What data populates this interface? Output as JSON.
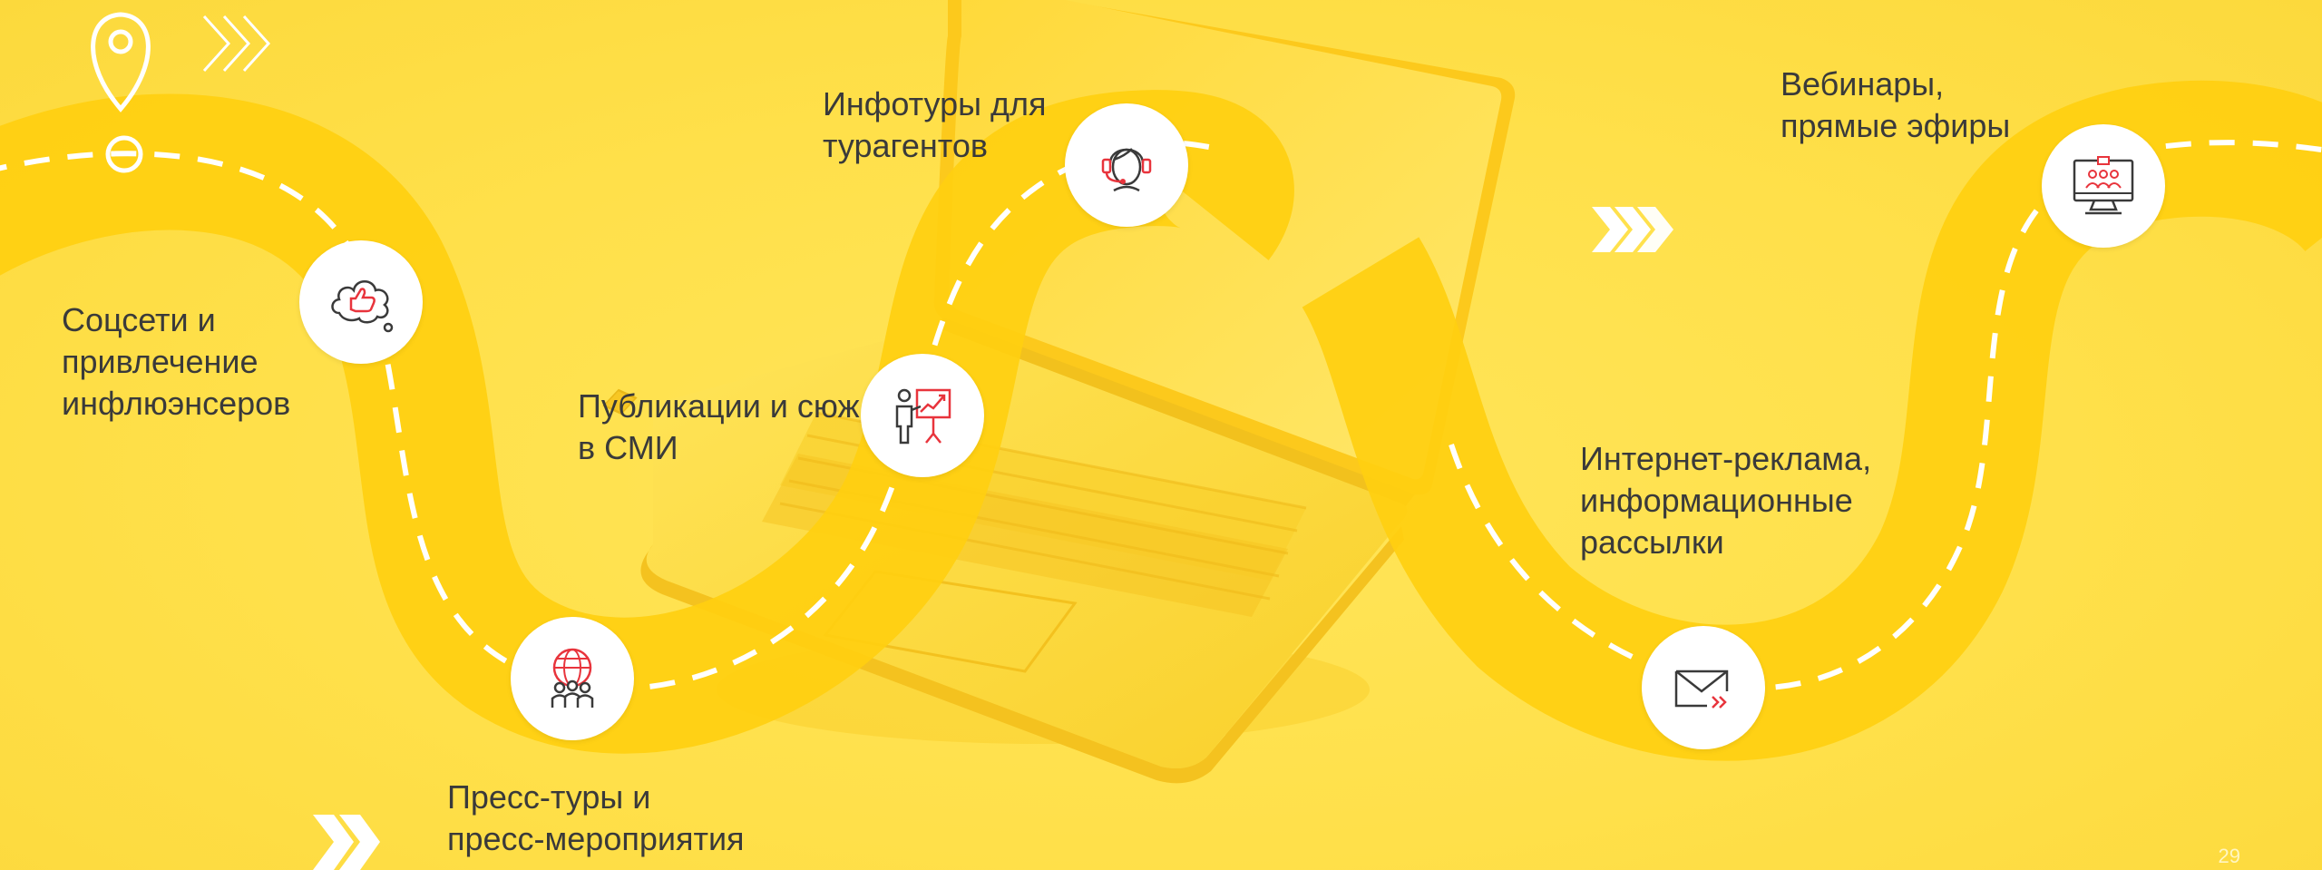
{
  "slide": {
    "page_number": "29",
    "colors": {
      "background": "#ffe148",
      "road": "#ffcf10",
      "dash": "#ffffff",
      "icon_dark": "#3a3a3a",
      "icon_red": "#e8343c"
    },
    "channels": [
      {
        "id": "social",
        "label": "Соцсети и\nпривлечение\nинфлюэнсеров",
        "icon": "thumbs-up-cloud-icon"
      },
      {
        "id": "press-tours",
        "label": "Пресс-туры и\nпресс-мероприятия",
        "icon": "globe-people-icon"
      },
      {
        "id": "publications",
        "label": "Публикации и сюж\nв СМИ",
        "icon": "presenter-chart-icon"
      },
      {
        "id": "infotours",
        "label": "Инфотуры для\nтурагентов",
        "icon": "headset-agent-icon"
      },
      {
        "id": "internet-ads",
        "label": "Интернет-реклама,\nинформационные\nрассылки",
        "icon": "envelope-send-icon"
      },
      {
        "id": "webinars",
        "label": "Вебинары,\nпрямые эфиры",
        "icon": "monitor-audience-icon"
      }
    ],
    "decorations": [
      "map-pin-icon",
      "outline-chevrons-icon",
      "double-chevron-icon",
      "double-chevron-icon"
    ]
  }
}
